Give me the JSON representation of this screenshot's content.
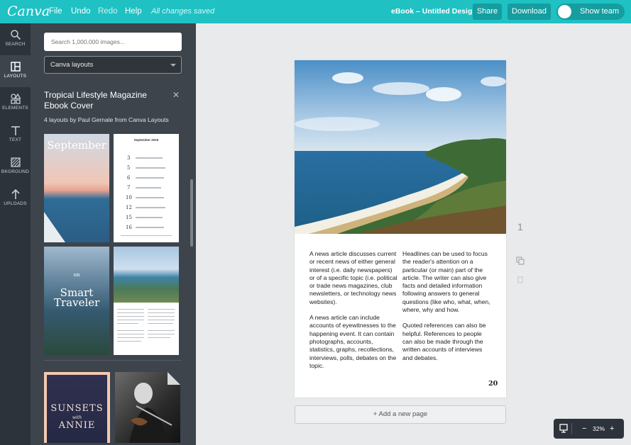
{
  "app": {
    "logo": "Canva"
  },
  "topbar": {
    "file": "File",
    "undo": "Undo",
    "redo": "Redo",
    "help": "Help",
    "saved_status": "All changes saved",
    "doc_title": "eBook – Untitled Design",
    "share": "Share",
    "download": "Download",
    "show_team": "Show team"
  },
  "rail": [
    {
      "label": "SEARCH",
      "icon": "search-icon"
    },
    {
      "label": "LAYOUTS",
      "icon": "layouts-icon",
      "active": true
    },
    {
      "label": "ELEMENTS",
      "icon": "elements-icon"
    },
    {
      "label": "TEXT",
      "icon": "text-icon"
    },
    {
      "label": "BKGROUND",
      "icon": "background-icon"
    },
    {
      "label": "UPLOADS",
      "icon": "upload-icon"
    }
  ],
  "panel": {
    "search_placeholder": "Search 1,000,000 images...",
    "dropdown_value": "Canva layouts",
    "title": "Tropical Lifestyle Magazine Ebook Cover",
    "subtitle": "4 layouts by Paul Gernale from Canva Layouts",
    "thumbs": {
      "t1_title": "September",
      "t2_header": "September 2016",
      "t2_numbers": [
        "3",
        "5",
        "6",
        "7",
        "10",
        "12",
        "15",
        "16"
      ],
      "t3_small": "on",
      "t3_title": "Smart Traveler",
      "t5_line1": "SUNSETS",
      "t5_with": "with",
      "t5_line2": "ANNIE"
    }
  },
  "page": {
    "col1": [
      "A news article discusses current or recent news of either general interest (i.e. daily newspapers) or of a specific topic (i.e. political or trade news magazines, club newsletters, or technology news websites).",
      "A news article can include accounts of eyewitnesses to the happening event. It can contain photographs, accounts, statistics, graphs, recollections, interviews, polls, debates on the topic."
    ],
    "col2": [
      "Headlines can be used to focus the reader's attention on a particular (or main) part of the article. The writer can also give facts and detailed information following answers to general questions (like who, what, when, where, why and how.",
      "Quoted references can also be helpful. References to people can also be made through the written accounts of interviews and debates."
    ],
    "page_number": "20",
    "side_page_index": "1",
    "add_page": "+ Add a new page"
  },
  "zoom": {
    "value": "32%",
    "minus": "−",
    "plus": "+"
  },
  "colors": {
    "brand": "#1fc1c3",
    "rail": "#2d333a",
    "panel": "#3d444c"
  }
}
